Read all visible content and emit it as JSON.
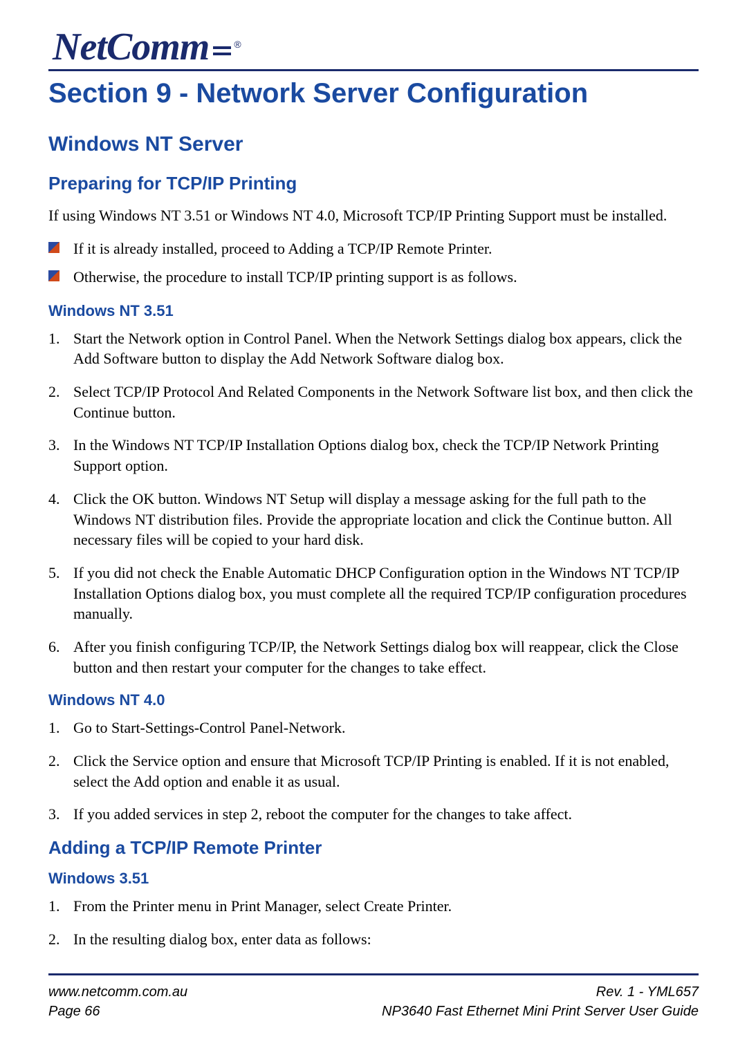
{
  "logo": {
    "brand": "NetComm"
  },
  "section_title": "Section 9 - Network Server Configuration",
  "h2_windows_nt_server": "Windows NT Server",
  "h3_preparing": "Preparing for TCP/IP Printing",
  "intro_para": "If using Windows NT 3.51 or Windows NT 4.0, Microsoft TCP/IP Printing Support must be installed.",
  "bullets": [
    "If it is already installed, proceed to Adding a TCP/IP Remote Printer.",
    "Otherwise, the procedure to install TCP/IP printing support is as follows."
  ],
  "h4_nt351": "Windows NT 3.51",
  "nt351_steps": [
    "Start the Network option in Control Panel. When the Network Settings dialog box appears, click the Add Software button to display the Add Network Software dialog box.",
    "Select TCP/IP Protocol And Related Components in the Network Software list box, and then click the Continue button.",
    "In the Windows NT TCP/IP Installation Options dialog box, check the TCP/IP Network Printing Support option.",
    "Click the OK button. Windows NT Setup will display a message asking for the full path to the Windows NT distribution files. Provide the appropriate location and click the Continue button. All necessary files will be copied to your hard disk.",
    "If you did not check the Enable Automatic DHCP Configuration option in the Windows NT TCP/IP Installation Options dialog box, you must complete all the required TCP/IP configuration procedures manually.",
    "After you finish configuring TCP/IP, the Network Settings dialog box will reappear, click the Close button and then restart your computer for the changes to take effect."
  ],
  "h4_nt40": "Windows NT 4.0",
  "nt40_steps": [
    "Go to Start-Settings-Control Panel-Network.",
    "Click the Service option and ensure that Microsoft TCP/IP Printing is enabled. If it is not enabled, select the Add option and enable it as usual.",
    "If you added services in step 2, reboot the computer for the changes to take affect."
  ],
  "h3_adding": "Adding a TCP/IP Remote Printer",
  "h4_win351": "Windows 3.51",
  "win351_steps": [
    "From the Printer menu in Print Manager, select Create Printer.",
    "In the resulting dialog box, enter data as follows:"
  ],
  "footer": {
    "left_line1": "www.netcomm.com.au",
    "left_line2": "Page 66",
    "right_line1": "Rev. 1 - YML657",
    "right_line2": "NP3640  Fast Ethernet Mini Print Server User Guide"
  }
}
